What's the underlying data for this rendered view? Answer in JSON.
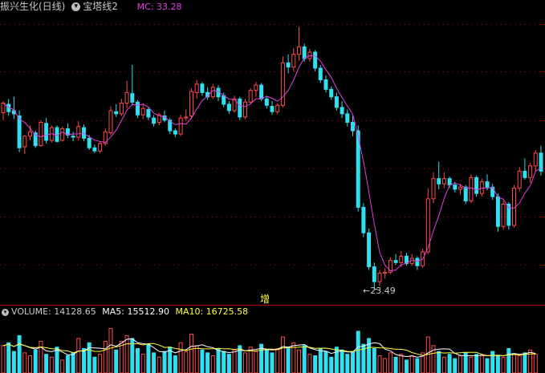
{
  "header": {
    "stock_title": "振兴生化(日线)",
    "indicator_name": "宝塔线2",
    "mc_text": "MC: 33.28",
    "dropdown_icon": "chevron-down-icon"
  },
  "price_panel": {
    "low_marker_label": "23.49",
    "center_label": "增"
  },
  "volume_panel": {
    "volume_text": "VOLUME: 14128.65",
    "ma5_text": "MA5: 15512.90",
    "ma10_text": "MA10: 16725.58"
  },
  "colors": {
    "up": "#ff4a4a",
    "down": "#30e0f0",
    "ma_line": "#e040e0",
    "grid": "#b00000",
    "title_text": "#c8c8c8",
    "mc_text": "#e040e0",
    "vol_ma5": "#ffffff",
    "vol_ma10": "#ffff40"
  },
  "chart_data": {
    "type": "candlestick",
    "low_marker": 23.49,
    "candles": [
      [
        40.1,
        41.2,
        39.4,
        41.0
      ],
      [
        40.9,
        41.4,
        39.8,
        40.2
      ],
      [
        40.3,
        41.6,
        39.5,
        40.0
      ],
      [
        39.8,
        40.3,
        36.4,
        36.8
      ],
      [
        36.9,
        38.0,
        36.2,
        37.9
      ],
      [
        37.9,
        38.9,
        37.5,
        38.3
      ],
      [
        38.2,
        38.4,
        36.8,
        37.0
      ],
      [
        37.0,
        39.4,
        36.9,
        39.2
      ],
      [
        39.1,
        39.6,
        37.2,
        37.5
      ],
      [
        37.5,
        38.9,
        37.3,
        38.7
      ],
      [
        38.7,
        38.9,
        37.3,
        37.4
      ],
      [
        37.5,
        38.8,
        37.4,
        38.6
      ],
      [
        38.6,
        39.1,
        37.7,
        38.0
      ],
      [
        37.9,
        38.3,
        37.4,
        37.8
      ],
      [
        37.8,
        39.3,
        37.5,
        38.8
      ],
      [
        38.7,
        39.0,
        37.4,
        37.7
      ],
      [
        37.7,
        38.0,
        36.6,
        36.8
      ],
      [
        36.8,
        37.1,
        36.3,
        36.5
      ],
      [
        36.5,
        37.4,
        36.3,
        37.2
      ],
      [
        37.2,
        38.6,
        37.0,
        38.3
      ],
      [
        38.2,
        40.7,
        38.0,
        40.3
      ],
      [
        40.2,
        40.9,
        39.7,
        40.0
      ],
      [
        40.0,
        41.4,
        39.8,
        41.0
      ],
      [
        41.0,
        43.1,
        40.5,
        42.0
      ],
      [
        41.9,
        44.6,
        40.8,
        41.1
      ],
      [
        41.1,
        41.3,
        39.6,
        39.9
      ],
      [
        39.9,
        41.0,
        39.5,
        40.5
      ],
      [
        40.4,
        40.6,
        39.4,
        39.7
      ],
      [
        39.6,
        39.9,
        38.8,
        39.1
      ],
      [
        39.2,
        40.1,
        38.9,
        39.9
      ],
      [
        39.8,
        40.3,
        39.2,
        39.4
      ],
      [
        39.4,
        39.6,
        38.1,
        38.4
      ],
      [
        38.4,
        38.6,
        37.8,
        38.1
      ],
      [
        38.1,
        39.9,
        37.9,
        39.6
      ],
      [
        39.6,
        40.4,
        39.3,
        39.7
      ],
      [
        39.8,
        42.4,
        39.6,
        42.1
      ],
      [
        42.0,
        43.2,
        41.4,
        42.8
      ],
      [
        42.8,
        43.0,
        41.7,
        42.0
      ],
      [
        42.0,
        42.5,
        41.3,
        41.6
      ],
      [
        41.6,
        42.8,
        41.4,
        42.5
      ],
      [
        42.4,
        42.7,
        41.2,
        41.6
      ],
      [
        41.7,
        42.0,
        40.6,
        40.9
      ],
      [
        40.9,
        41.2,
        40.0,
        40.3
      ],
      [
        40.3,
        41.7,
        40.1,
        41.4
      ],
      [
        41.4,
        41.6,
        39.4,
        39.7
      ],
      [
        39.7,
        41.4,
        39.5,
        41.1
      ],
      [
        41.1,
        42.4,
        40.9,
        42.2
      ],
      [
        42.2,
        43.0,
        41.6,
        42.7
      ],
      [
        42.7,
        42.9,
        41.2,
        41.4
      ],
      [
        41.4,
        41.7,
        40.5,
        40.8
      ],
      [
        40.7,
        41.2,
        39.9,
        40.2
      ],
      [
        40.2,
        41.0,
        40.0,
        40.8
      ],
      [
        40.8,
        45.4,
        40.6,
        44.8
      ],
      [
        44.8,
        45.6,
        43.8,
        44.4
      ],
      [
        44.4,
        46.2,
        44.0,
        45.6
      ],
      [
        45.6,
        48.2,
        45.0,
        46.3
      ],
      [
        46.3,
        46.6,
        44.9,
        45.2
      ],
      [
        45.2,
        46.1,
        44.9,
        45.8
      ],
      [
        45.8,
        46.0,
        44.0,
        44.3
      ],
      [
        44.3,
        44.6,
        42.9,
        43.2
      ],
      [
        43.2,
        43.6,
        42.0,
        42.3
      ],
      [
        42.3,
        42.6,
        41.3,
        41.6
      ],
      [
        41.6,
        42.0,
        40.3,
        40.6
      ],
      [
        40.6,
        41.2,
        39.6,
        40.0
      ],
      [
        40.0,
        40.4,
        38.8,
        39.2
      ],
      [
        39.2,
        39.8,
        37.9,
        38.4
      ],
      [
        38.4,
        38.9,
        30.8,
        31.2
      ],
      [
        31.2,
        31.6,
        28.4,
        28.8
      ],
      [
        28.8,
        29.2,
        25.3,
        25.6
      ],
      [
        25.6,
        26.0,
        23.49,
        24.2
      ],
      [
        24.2,
        25.3,
        23.8,
        25.0
      ],
      [
        25.0,
        25.5,
        24.5,
        25.1
      ],
      [
        25.1,
        26.5,
        24.9,
        26.2
      ],
      [
        26.2,
        26.8,
        25.8,
        26.0
      ],
      [
        26.0,
        27.1,
        25.6,
        26.6
      ],
      [
        26.6,
        26.9,
        25.7,
        25.9
      ],
      [
        25.9,
        26.8,
        25.7,
        26.4
      ],
      [
        26.4,
        26.6,
        25.3,
        25.7
      ],
      [
        25.7,
        27.3,
        25.5,
        27.0
      ],
      [
        27.0,
        33.0,
        26.8,
        32.0
      ],
      [
        32.0,
        34.5,
        31.6,
        33.9
      ],
      [
        33.9,
        35.5,
        32.9,
        33.4
      ],
      [
        33.4,
        34.5,
        33.0,
        33.9
      ],
      [
        33.9,
        34.1,
        33.0,
        33.3
      ],
      [
        33.3,
        33.6,
        32.6,
        32.9
      ],
      [
        32.9,
        33.4,
        32.4,
        33.1
      ],
      [
        33.1,
        33.3,
        31.5,
        31.8
      ],
      [
        31.8,
        34.3,
        31.6,
        34.0
      ],
      [
        34.0,
        34.2,
        32.2,
        32.5
      ],
      [
        32.5,
        33.9,
        32.2,
        33.6
      ],
      [
        33.6,
        34.3,
        32.8,
        33.1
      ],
      [
        33.1,
        33.4,
        31.9,
        32.2
      ],
      [
        32.2,
        32.5,
        28.9,
        29.4
      ],
      [
        29.4,
        31.8,
        29.1,
        31.5
      ],
      [
        31.5,
        31.7,
        29.1,
        29.5
      ],
      [
        29.5,
        33.3,
        29.3,
        33.0
      ],
      [
        33.0,
        35.0,
        32.7,
        34.6
      ],
      [
        34.6,
        35.8,
        33.8,
        34.0
      ],
      [
        34.0,
        35.4,
        33.5,
        35.1
      ],
      [
        35.1,
        36.6,
        34.6,
        36.3
      ],
      [
        36.3,
        37.0,
        34.2,
        34.6
      ]
    ],
    "volume": [
      19000,
      21000,
      15000,
      26000,
      14000,
      12000,
      16000,
      22000,
      13000,
      11000,
      18000,
      9000,
      12000,
      14000,
      24000,
      17000,
      21000,
      11000,
      13000,
      22000,
      31000,
      16000,
      22000,
      26000,
      24000,
      17000,
      13000,
      20000,
      14000,
      11000,
      15000,
      18000,
      12000,
      21000,
      15000,
      27000,
      19000,
      16000,
      14000,
      12000,
      17000,
      15000,
      13000,
      16000,
      19000,
      14000,
      18000,
      15000,
      20000,
      16000,
      14000,
      17000,
      25000,
      18000,
      21000,
      16000,
      19000,
      13000,
      12000,
      17000,
      15000,
      11000,
      18000,
      16000,
      13000,
      15000,
      29000,
      20000,
      24000,
      17000,
      12000,
      10000,
      14000,
      11000,
      13000,
      9000,
      12000,
      10000,
      14000,
      25000,
      19000,
      15000,
      11000,
      13000,
      10000,
      12000,
      14000,
      11000,
      13000,
      12000,
      10000,
      15000,
      12000,
      11000,
      17000,
      13000,
      12000,
      14000,
      16000,
      13000
    ]
  }
}
